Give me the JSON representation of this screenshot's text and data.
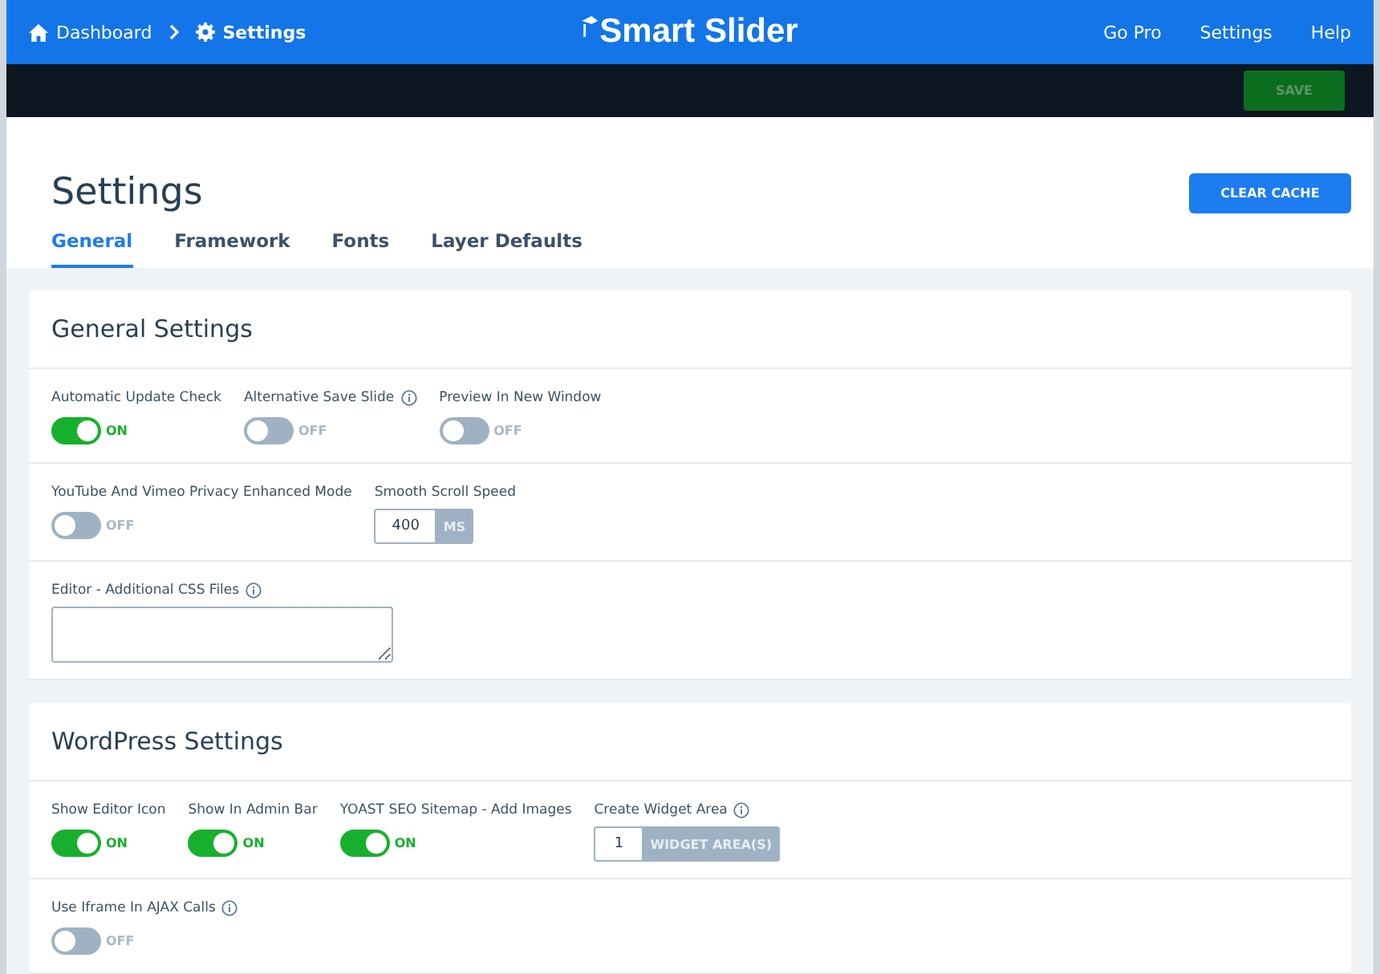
{
  "topbar": {
    "breadcrumbs": [
      {
        "label": "Dashboard"
      },
      {
        "label": "Settings"
      }
    ],
    "logo": "Smart Slider",
    "links": [
      "Go Pro",
      "Settings",
      "Help"
    ]
  },
  "actionbar": {
    "save": "SAVE"
  },
  "header": {
    "title": "Settings",
    "button": "CLEAR CACHE",
    "tabs": [
      {
        "label": "General",
        "selected": true
      },
      {
        "label": "Framework",
        "selected": false
      },
      {
        "label": "Fonts",
        "selected": false
      },
      {
        "label": "Layer Defaults",
        "selected": false
      }
    ]
  },
  "sections": [
    {
      "title": "General Settings",
      "rows": [
        [
          {
            "kind": "toggle",
            "label": "Automatic Update Check",
            "info": false,
            "on": true,
            "state": "ON"
          },
          {
            "kind": "toggle",
            "label": "Alternative Save Slide",
            "info": true,
            "on": false,
            "state": "OFF"
          },
          {
            "kind": "toggle",
            "label": "Preview In New Window",
            "info": false,
            "on": false,
            "state": "OFF"
          }
        ],
        [
          {
            "kind": "toggle",
            "label": "YouTube And Vimeo Privacy Enhanced Mode",
            "info": false,
            "on": false,
            "state": "OFF"
          },
          {
            "kind": "number",
            "label": "Smooth Scroll Speed",
            "info": false,
            "value": "400",
            "unit": "MS"
          }
        ],
        [
          {
            "kind": "textarea",
            "label": "Editor - Additional CSS Files",
            "info": true
          }
        ]
      ]
    },
    {
      "title": "WordPress Settings",
      "rows": [
        [
          {
            "kind": "toggle",
            "label": "Show Editor Icon",
            "info": false,
            "on": true,
            "state": "ON"
          },
          {
            "kind": "toggle",
            "label": "Show In Admin Bar",
            "info": false,
            "on": true,
            "state": "ON"
          },
          {
            "kind": "toggle",
            "label": "YOAST SEO Sitemap - Add Images",
            "info": false,
            "on": true,
            "state": "ON"
          },
          {
            "kind": "number",
            "label": "Create Widget Area",
            "info": true,
            "value": "1",
            "unit": "WIDGET AREA(S)"
          }
        ],
        [
          {
            "kind": "toggle",
            "label": "Use Iframe In AJAX Calls",
            "info": true,
            "on": false,
            "state": "OFF"
          }
        ]
      ]
    }
  ]
}
